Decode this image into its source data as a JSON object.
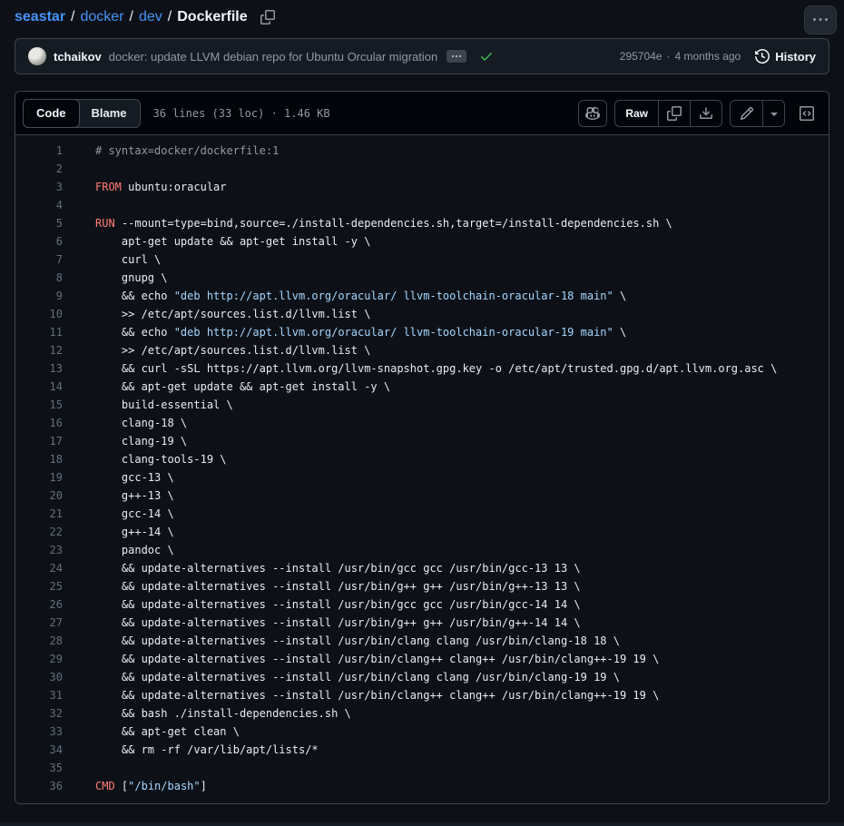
{
  "breadcrumb": {
    "separator": "/",
    "repo": "seastar",
    "dir1": "docker",
    "dir2": "dev",
    "file": "Dockerfile"
  },
  "commit": {
    "author": "tchaikov",
    "message": "docker: update LLVM debian repo for Ubuntu Orcular migration",
    "sha": "295704e",
    "dot": "·",
    "time": "4 months ago",
    "history_label": "History"
  },
  "toolbar": {
    "code_tab": "Code",
    "blame_tab": "Blame",
    "meta": "36 lines (33 loc) · 1.46 KB",
    "raw_label": "Raw"
  },
  "colors": {
    "page_bg": "#0d1117",
    "header_bg": "#010409",
    "panel_bg": "#151b23",
    "border": "#3d444d",
    "link_blue": "#4493f8",
    "keyword_red": "#ff7b72",
    "string_blue": "#a5d6ff",
    "comment_gray": "#9198a1",
    "success_green": "#3fb950",
    "line_number": "#636e7b"
  },
  "code": {
    "lines": [
      {
        "s": [
          [
            "c",
            "# syntax=docker/dockerfile:1"
          ]
        ]
      },
      {
        "s": []
      },
      {
        "s": [
          [
            "k",
            "FROM"
          ],
          [
            "",
            " ubuntu:oracular"
          ]
        ]
      },
      {
        "s": []
      },
      {
        "s": [
          [
            "k",
            "RUN"
          ],
          [
            "",
            " --mount=type=bind,source=./install-dependencies.sh,target=/install-dependencies.sh \\"
          ]
        ]
      },
      {
        "s": [
          [
            "",
            "    apt-get update && apt-get install -y \\"
          ]
        ]
      },
      {
        "s": [
          [
            "",
            "    curl \\"
          ]
        ]
      },
      {
        "s": [
          [
            "",
            "    gnupg \\"
          ]
        ]
      },
      {
        "s": [
          [
            "",
            "    && echo "
          ],
          [
            "s",
            "\"deb http://apt.llvm.org/oracular/ llvm-toolchain-oracular-18 main\""
          ],
          [
            "",
            " \\"
          ]
        ]
      },
      {
        "s": [
          [
            "",
            "    >> /etc/apt/sources.list.d/llvm.list \\"
          ]
        ]
      },
      {
        "s": [
          [
            "",
            "    && echo "
          ],
          [
            "s",
            "\"deb http://apt.llvm.org/oracular/ llvm-toolchain-oracular-19 main\""
          ],
          [
            "",
            " \\"
          ]
        ]
      },
      {
        "s": [
          [
            "",
            "    >> /etc/apt/sources.list.d/llvm.list \\"
          ]
        ]
      },
      {
        "s": [
          [
            "",
            "    && curl -sSL https://apt.llvm.org/llvm-snapshot.gpg.key -o /etc/apt/trusted.gpg.d/apt.llvm.org.asc \\"
          ]
        ]
      },
      {
        "s": [
          [
            "",
            "    && apt-get update && apt-get install -y \\"
          ]
        ]
      },
      {
        "s": [
          [
            "",
            "    build-essential \\"
          ]
        ]
      },
      {
        "s": [
          [
            "",
            "    clang-18 \\"
          ]
        ]
      },
      {
        "s": [
          [
            "",
            "    clang-19 \\"
          ]
        ]
      },
      {
        "s": [
          [
            "",
            "    clang-tools-19 \\"
          ]
        ]
      },
      {
        "s": [
          [
            "",
            "    gcc-13 \\"
          ]
        ]
      },
      {
        "s": [
          [
            "",
            "    g++-13 \\"
          ]
        ]
      },
      {
        "s": [
          [
            "",
            "    gcc-14 \\"
          ]
        ]
      },
      {
        "s": [
          [
            "",
            "    g++-14 \\"
          ]
        ]
      },
      {
        "s": [
          [
            "",
            "    pandoc \\"
          ]
        ]
      },
      {
        "s": [
          [
            "",
            "    && update-alternatives --install /usr/bin/gcc gcc /usr/bin/gcc-13 13 \\"
          ]
        ]
      },
      {
        "s": [
          [
            "",
            "    && update-alternatives --install /usr/bin/g++ g++ /usr/bin/g++-13 13 \\"
          ]
        ]
      },
      {
        "s": [
          [
            "",
            "    && update-alternatives --install /usr/bin/gcc gcc /usr/bin/gcc-14 14 \\"
          ]
        ]
      },
      {
        "s": [
          [
            "",
            "    && update-alternatives --install /usr/bin/g++ g++ /usr/bin/g++-14 14 \\"
          ]
        ]
      },
      {
        "s": [
          [
            "",
            "    && update-alternatives --install /usr/bin/clang clang /usr/bin/clang-18 18 \\"
          ]
        ]
      },
      {
        "s": [
          [
            "",
            "    && update-alternatives --install /usr/bin/clang++ clang++ /usr/bin/clang++-19 19 \\"
          ]
        ]
      },
      {
        "s": [
          [
            "",
            "    && update-alternatives --install /usr/bin/clang clang /usr/bin/clang-19 19 \\"
          ]
        ]
      },
      {
        "s": [
          [
            "",
            "    && update-alternatives --install /usr/bin/clang++ clang++ /usr/bin/clang++-19 19 \\"
          ]
        ]
      },
      {
        "s": [
          [
            "",
            "    && bash ./install-dependencies.sh \\"
          ]
        ]
      },
      {
        "s": [
          [
            "",
            "    && apt-get clean \\"
          ]
        ]
      },
      {
        "s": [
          [
            "",
            "    && rm -rf /var/lib/apt/lists/*"
          ]
        ]
      },
      {
        "s": []
      },
      {
        "s": [
          [
            "k",
            "CMD"
          ],
          [
            "",
            " ["
          ],
          [
            "s",
            "\"/bin/bash\""
          ],
          [
            "",
            "]"
          ]
        ]
      }
    ]
  }
}
